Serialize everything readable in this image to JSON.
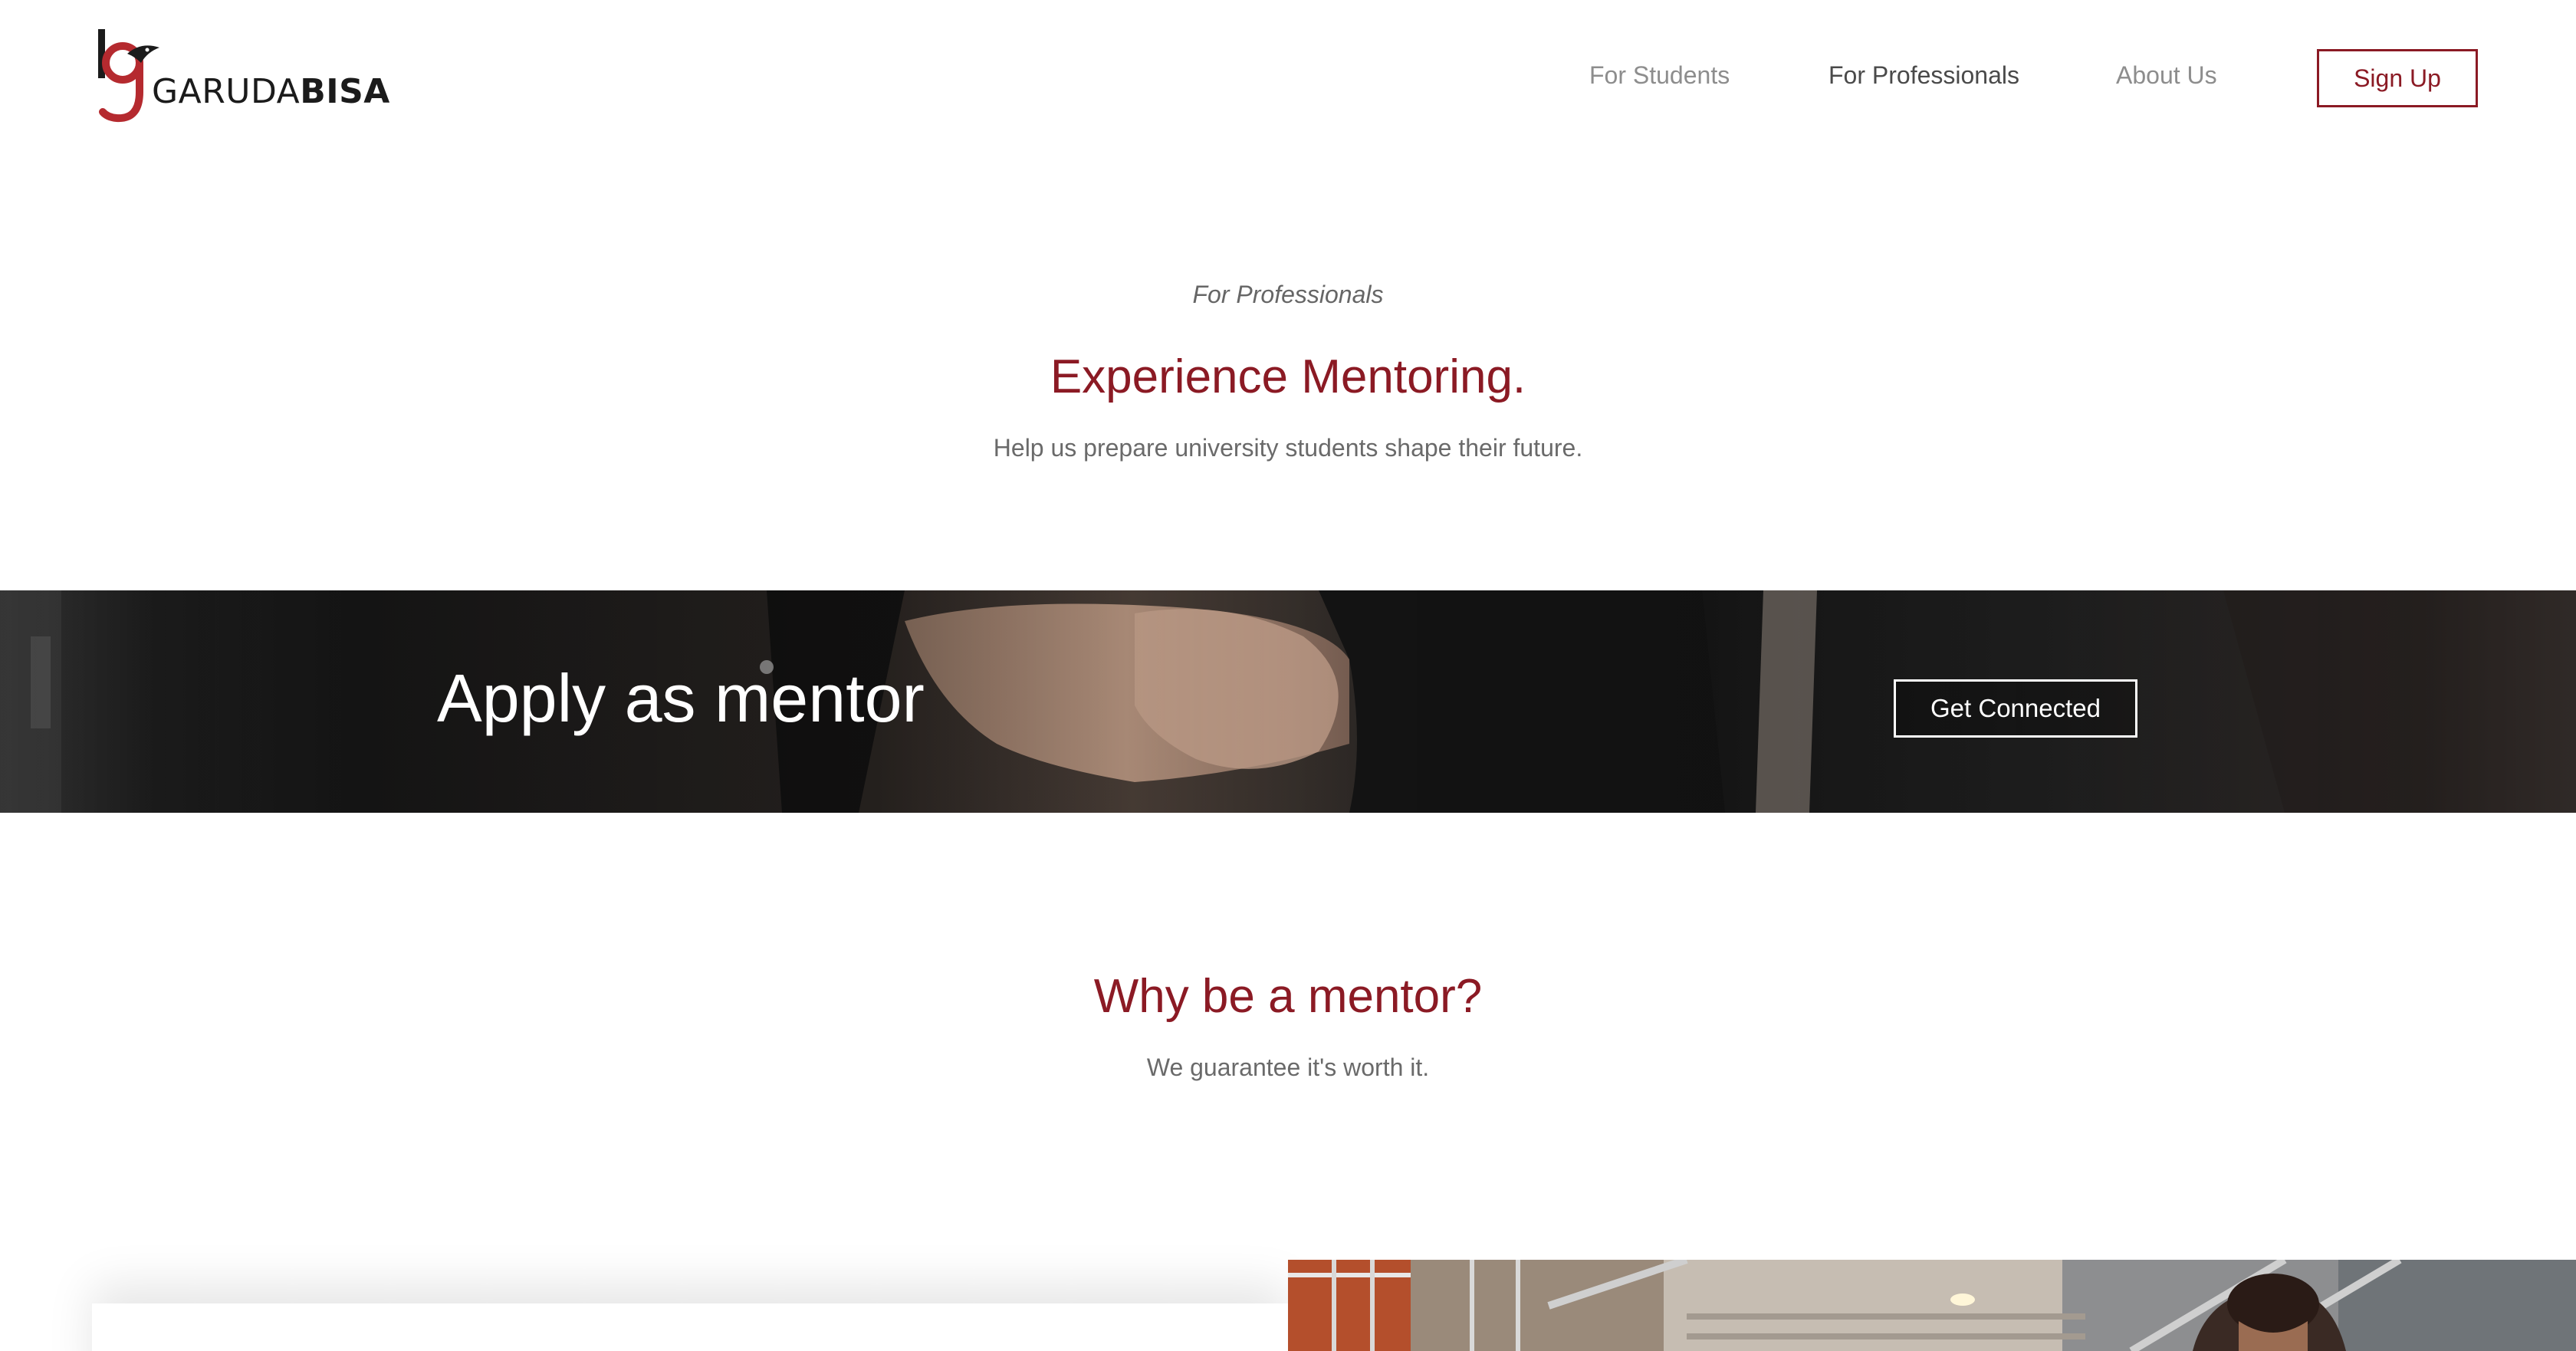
{
  "header": {
    "logo": {
      "brand_light": "GARUDA",
      "brand_bold": "BISA"
    },
    "nav": [
      {
        "label": "For Students",
        "active": false
      },
      {
        "label": "For Professionals",
        "active": true
      },
      {
        "label": "About Us",
        "active": false
      }
    ],
    "signup_label": "Sign Up"
  },
  "intro": {
    "eyebrow": "For Professionals",
    "title": "Experience Mentoring.",
    "subtitle": "Help us prepare university students shape their future."
  },
  "banner": {
    "title": "Apply as mentor",
    "cta_label": "Get Connected"
  },
  "why": {
    "title": "Why be a mentor?",
    "subtitle": "We guarantee it's worth it."
  },
  "colors": {
    "brand": "#8b1a24",
    "nav_text": "#8d8d8d",
    "nav_active": "#4a4a4a",
    "body_text": "#6a6a6a"
  }
}
